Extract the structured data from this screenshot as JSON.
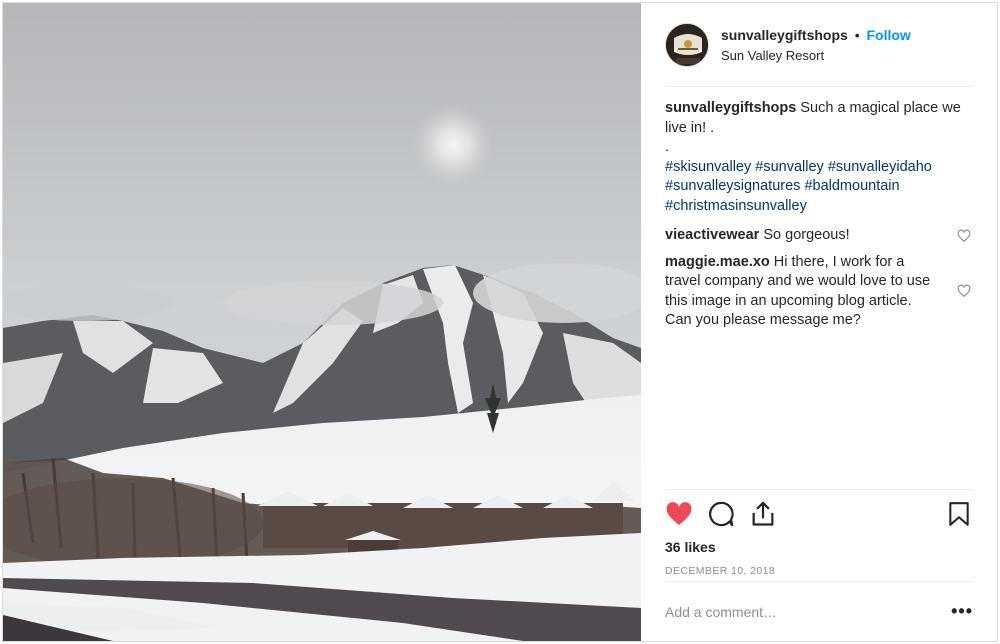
{
  "post": {
    "username": "sunvalleygiftshops",
    "separator": "•",
    "follow_label": "Follow",
    "location": "Sun Valley Resort",
    "photo_alt": "Snow-covered Bald Mountain with ski runs under an overcast sky",
    "avatar_alt": "Sun Valley Gift Shops logo"
  },
  "caption": {
    "username": "sunvalleygiftshops",
    "text": "Such a magical place we live in! .",
    "dot_line": ".",
    "hashtags_line1": [
      "#skisunvalley",
      "#sunvalley",
      "#sunvalleyidaho"
    ],
    "hashtags_line2": [
      "#sunvalleysignatures",
      "#baldmountain"
    ],
    "hashtags_line3": [
      "#christmasinsunvalley"
    ]
  },
  "comments": [
    {
      "username": "vieactivewear",
      "text": "So gorgeous!"
    },
    {
      "username": "maggie.mae.xo",
      "text": "Hi there, I work for a travel company and we would love to use this image in an upcoming blog article. Can you please message me?"
    }
  ],
  "actions": {
    "like_icon": "heart-filled-icon",
    "comment_icon": "comment-icon",
    "share_icon": "share-icon",
    "save_icon": "bookmark-icon",
    "like_color": "#ed4956"
  },
  "likes": "36 likes",
  "date": "DECEMBER 10, 2018",
  "add_comment": {
    "placeholder": "Add a comment…",
    "more_label": "•••"
  }
}
